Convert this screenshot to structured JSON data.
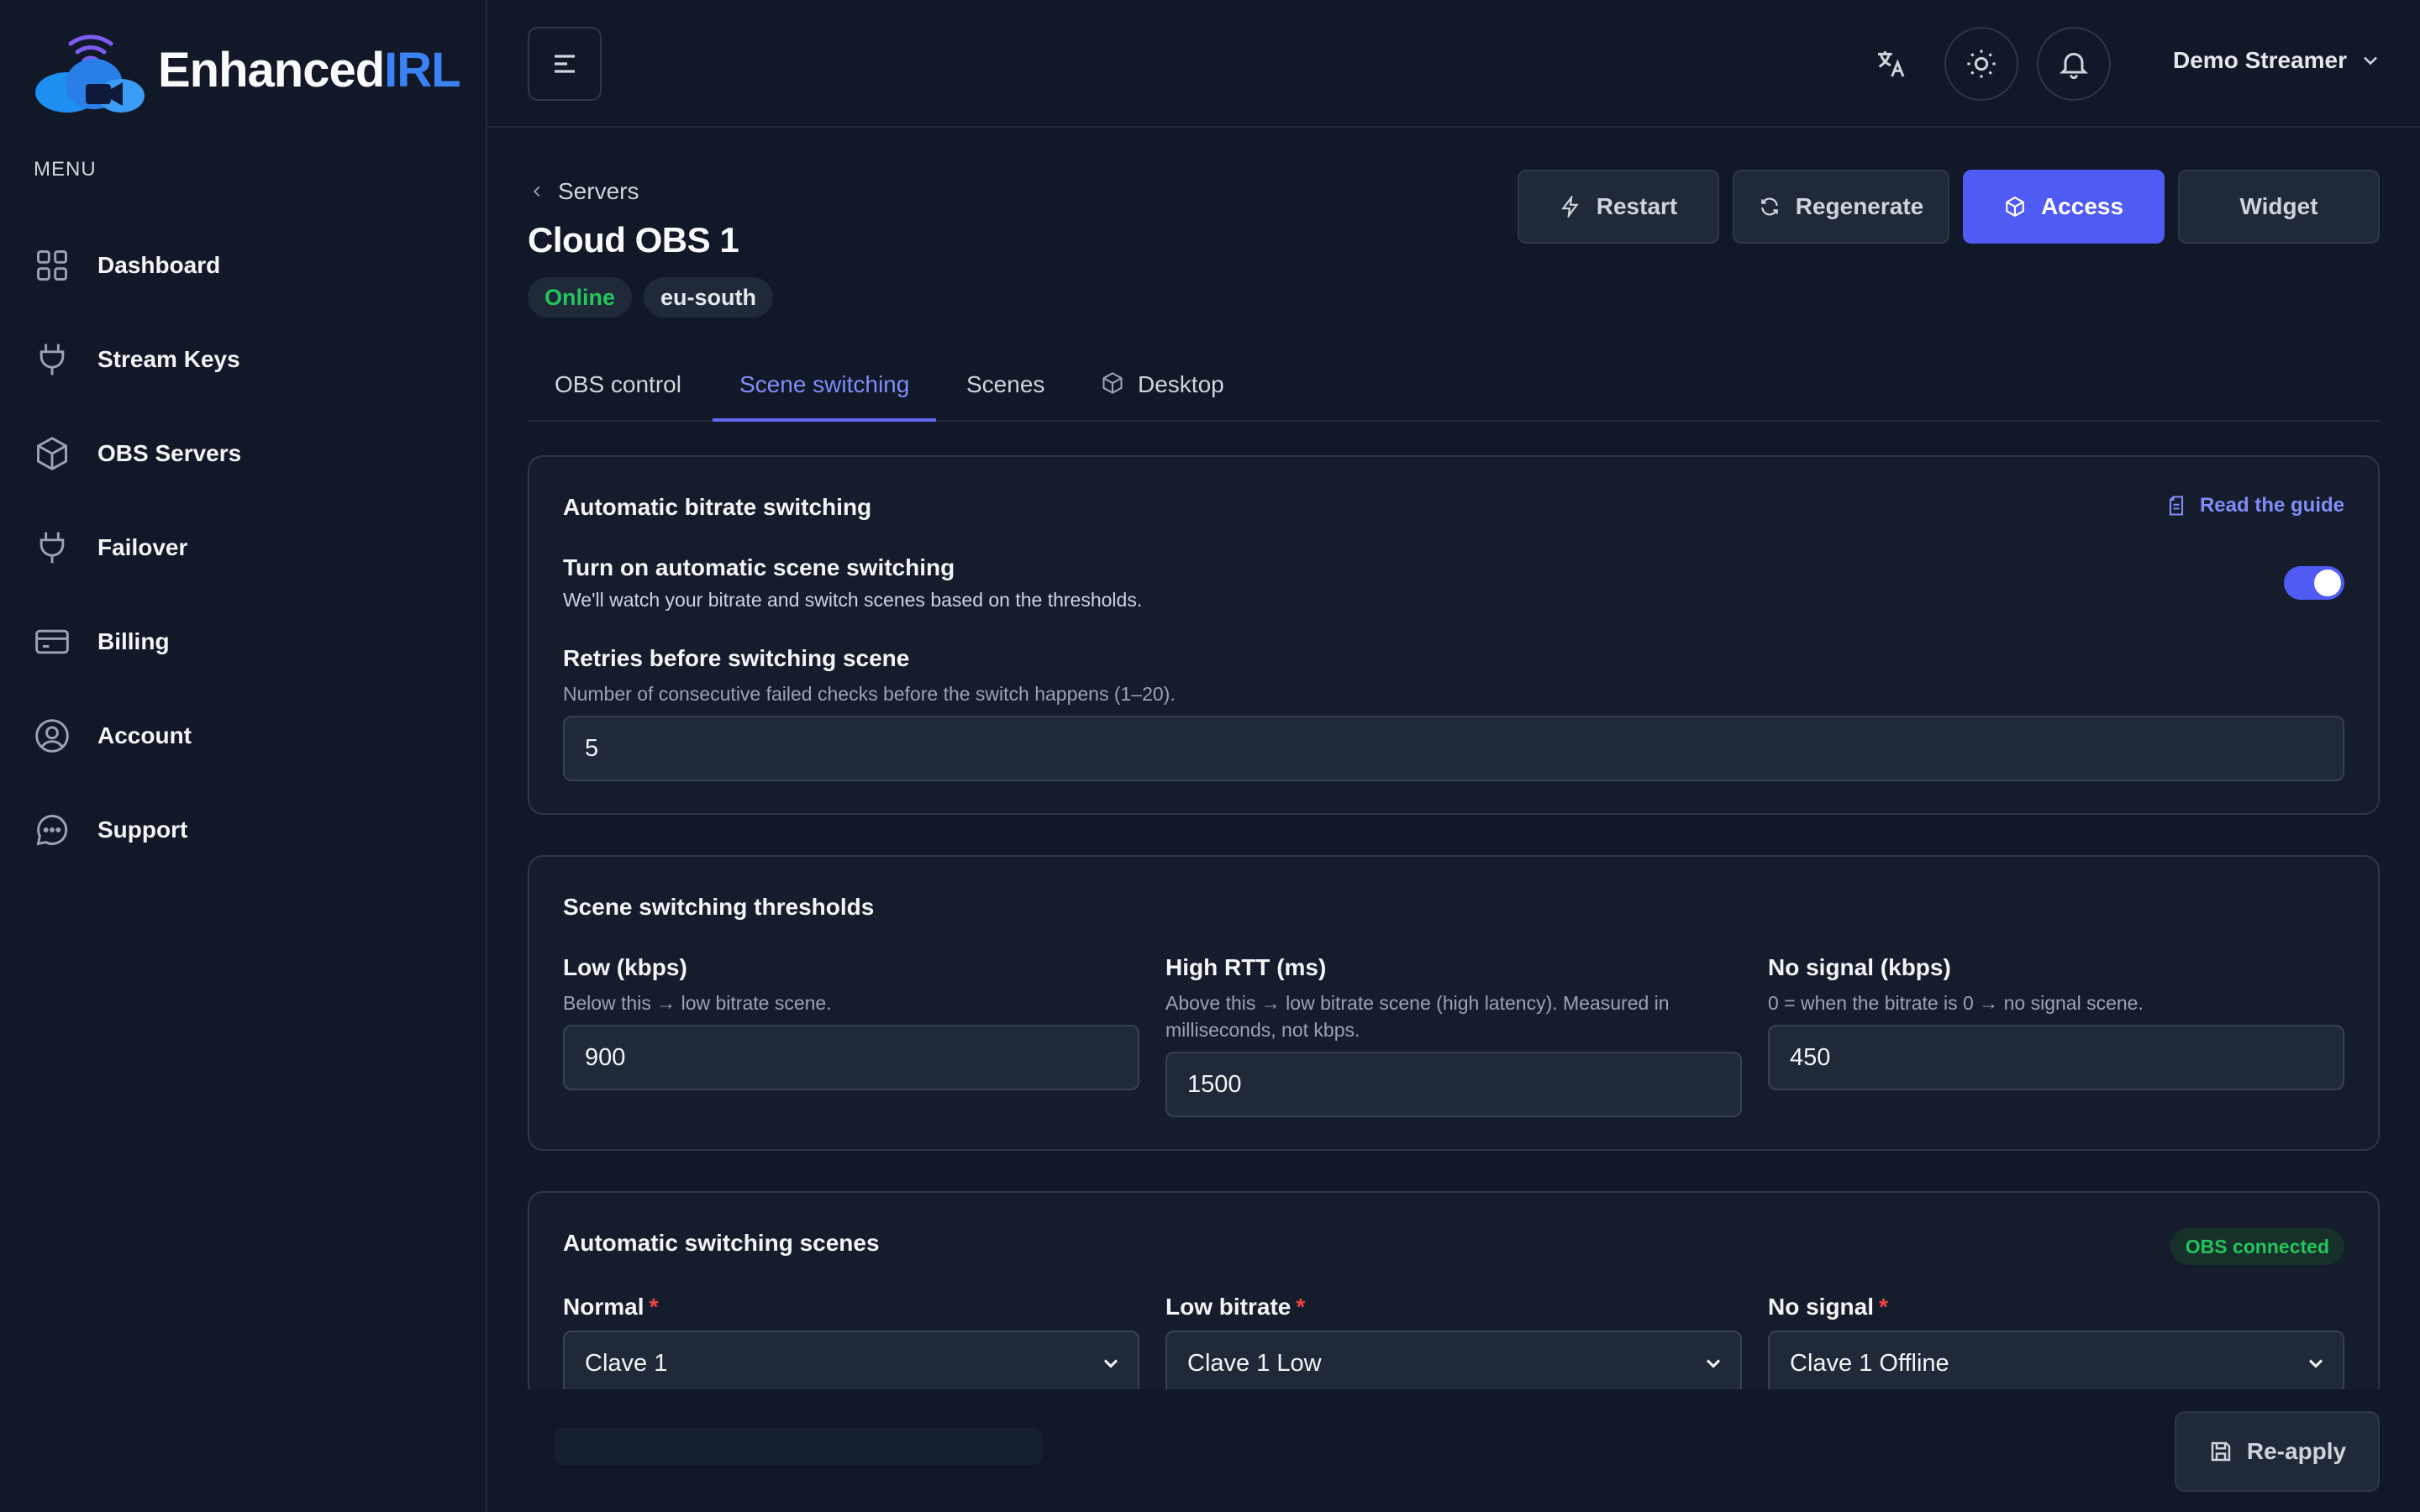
{
  "brand": {
    "name_part1": "Enhanced",
    "name_part2": "IRL"
  },
  "sidebar": {
    "menu_label": "MENU",
    "items": [
      {
        "label": "Dashboard",
        "icon": "grid-icon"
      },
      {
        "label": "Stream Keys",
        "icon": "plug-icon"
      },
      {
        "label": "OBS Servers",
        "icon": "cube-icon"
      },
      {
        "label": "Failover",
        "icon": "plug-icon"
      },
      {
        "label": "Billing",
        "icon": "credit-card-icon"
      },
      {
        "label": "Account",
        "icon": "user-circle-icon"
      },
      {
        "label": "Support",
        "icon": "chat-icon"
      }
    ]
  },
  "header": {
    "user_name": "Demo Streamer"
  },
  "page": {
    "breadcrumb": "Servers",
    "title": "Cloud OBS 1",
    "status": "Online",
    "region": "eu-south",
    "actions": {
      "restart": "Restart",
      "regenerate": "Regenerate",
      "access": "Access",
      "widget": "Widget"
    },
    "tabs": [
      "OBS control",
      "Scene switching",
      "Scenes",
      "Desktop"
    ],
    "active_tab": "Scene switching"
  },
  "bitrate_card": {
    "title": "Automatic bitrate switching",
    "guide_link": "Read the guide",
    "toggle_label": "Turn on automatic scene switching",
    "toggle_hint": "We'll watch your bitrate and switch scenes based on the thresholds.",
    "toggle_on": true,
    "retries_label": "Retries before switching scene",
    "retries_hint": "Number of consecutive failed checks before the switch happens (1–20).",
    "retries_value": "5"
  },
  "thresholds_card": {
    "title": "Scene switching thresholds",
    "low_label": "Low (kbps)",
    "low_hint": "Below this → low bitrate scene.",
    "low_value": "900",
    "rtt_label": "High RTT (ms)",
    "rtt_hint_line1": "Above this → low bitrate scene (high latency). Measured in",
    "rtt_hint_line2": "milliseconds, not kbps.",
    "rtt_value": "1500",
    "nosignal_label": "No signal (kbps)",
    "nosignal_hint": "0 = when the bitrate is 0 → no signal scene.",
    "nosignal_value": "450"
  },
  "scenes_card": {
    "title": "Automatic switching scenes",
    "status_badge": "OBS connected",
    "required_mark": "*",
    "normal_label": "Normal",
    "normal_value": "Clave 1",
    "low_label": "Low bitrate",
    "low_value": "Clave 1 Low",
    "nosignal_label": "No signal",
    "nosignal_value": "Clave 1 Offline"
  },
  "footer": {
    "reapply": "Re-apply"
  },
  "colors": {
    "accent": "#4f5bf2",
    "link": "#818cf8",
    "success": "#22c55e",
    "danger": "#ef4444",
    "background": "#111827",
    "card": "#151d2c"
  }
}
